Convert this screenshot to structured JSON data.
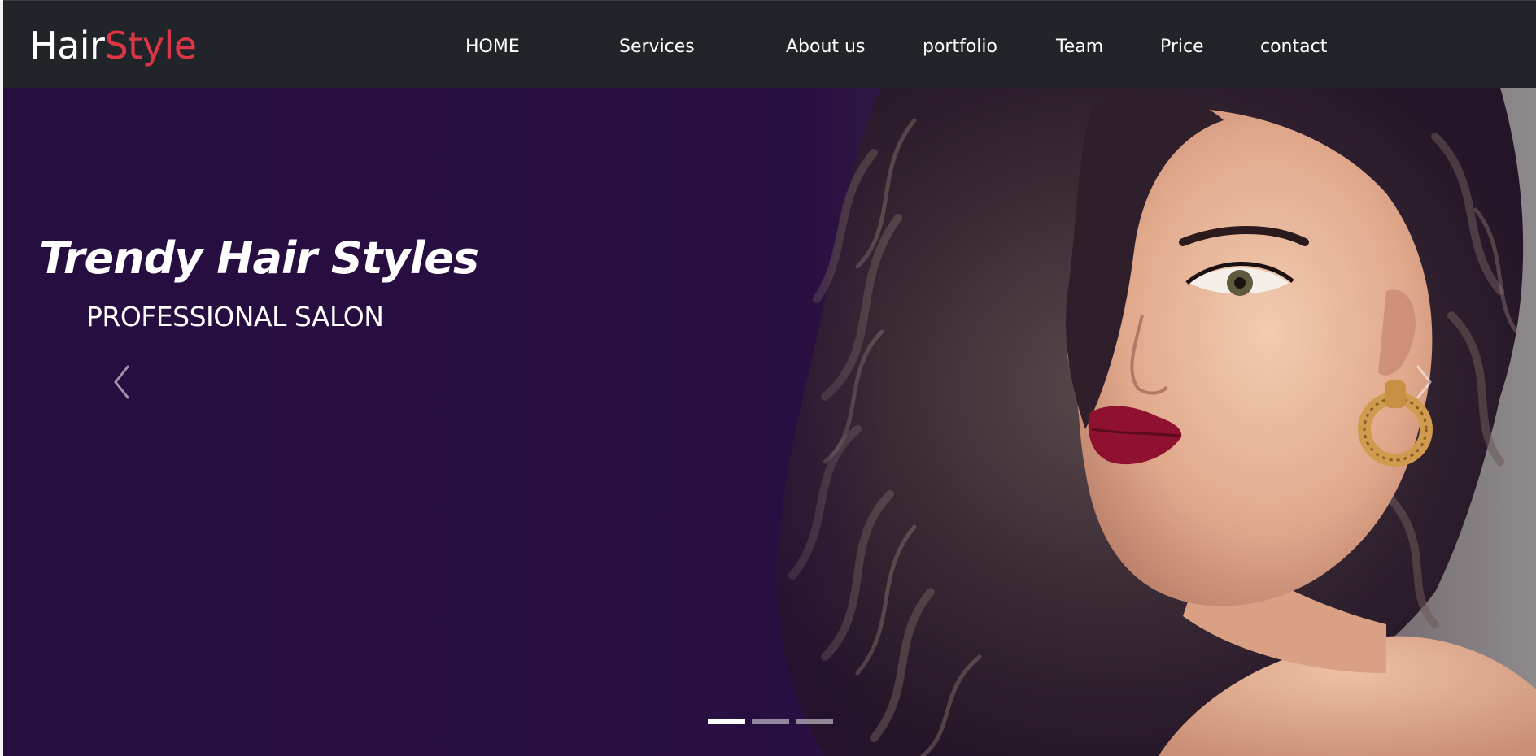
{
  "brand": {
    "part1": "Hair",
    "part2": "Style",
    "part2_color": "#dc3545"
  },
  "nav": {
    "items": [
      "HOME",
      "Services",
      "About us",
      "portfolio",
      "Team",
      "Price",
      "contact"
    ]
  },
  "hero": {
    "title": "Trendy Hair Styles",
    "subtitle": "PROFESSIONAL SALON",
    "background_color": "#260d3f",
    "prev_icon": "chevron-left-icon",
    "next_icon": "chevron-right-icon",
    "slides_total": 3,
    "active_slide": 1
  },
  "colors": {
    "navbar": "#212529",
    "accent": "#dc3545"
  }
}
